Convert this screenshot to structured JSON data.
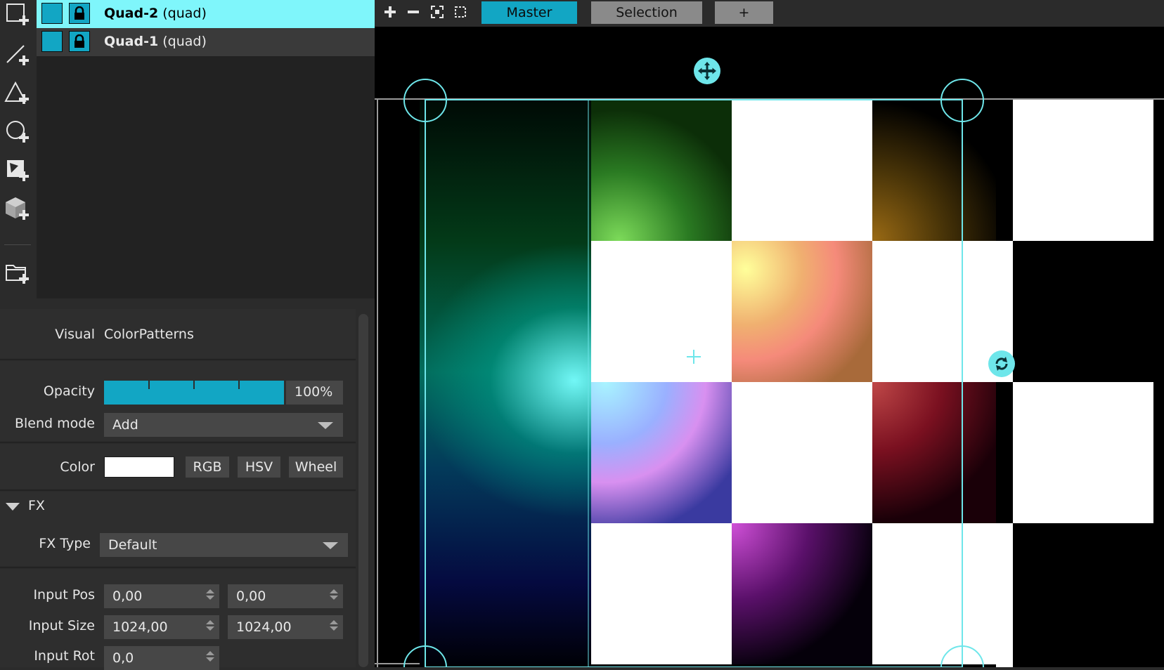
{
  "toolbar": {
    "tools": [
      {
        "icon": "add-rectangle-icon"
      },
      {
        "icon": "add-line-icon"
      },
      {
        "icon": "add-triangle-icon"
      },
      {
        "icon": "add-circle-icon"
      },
      {
        "icon": "add-mask-icon"
      },
      {
        "icon": "add-3d-object-icon"
      },
      {
        "icon": "add-folder-icon"
      }
    ]
  },
  "layers": [
    {
      "name": "Quad-2",
      "type": "(quad)",
      "selected": true,
      "color": "#12a6c4",
      "icon": "lock-icon"
    },
    {
      "name": "Quad-1",
      "type": "(quad)",
      "selected": false,
      "color": "#12a6c4",
      "icon": "lock-icon"
    }
  ],
  "props": {
    "visual_label": "Visual",
    "visual_value": "ColorPatterns",
    "opacity_label": "Opacity",
    "opacity_value": "100%",
    "opacity_fraction": 1.0,
    "blend_label": "Blend mode",
    "blend_value": "Add",
    "color_label": "Color",
    "color_value": "#ffffff",
    "color_buttons": [
      "RGB",
      "HSV",
      "Wheel"
    ],
    "fx_header": "FX",
    "fx_type_label": "FX Type",
    "fx_type_value": "Default",
    "input_pos_label": "Input Pos",
    "input_pos_x": "0,00",
    "input_pos_y": "0,00",
    "input_size_label": "Input Size",
    "input_size_w": "1024,00",
    "input_size_h": "1024,00",
    "input_rot_label": "Input Rot",
    "input_rot_value": "0,0"
  },
  "topbar": {
    "icons": [
      "plus-icon",
      "minus-icon",
      "fit-icon",
      "selection-frame-icon"
    ],
    "tabs": [
      {
        "label": "Master",
        "active": true
      },
      {
        "label": "Selection",
        "active": false
      },
      {
        "label": "+",
        "active": false
      }
    ]
  },
  "colors": {
    "accent": "#12a6c4",
    "selection": "#7ff6fb",
    "handle": "#6ee6ea"
  }
}
